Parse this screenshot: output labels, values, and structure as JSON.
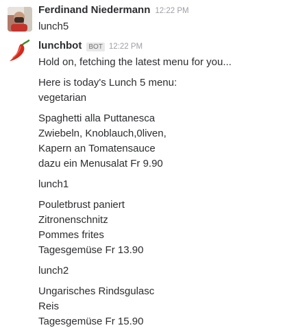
{
  "messages": [
    {
      "sender": "Ferdinand Niedermann",
      "timestamp": "12:22 PM",
      "avatar_icon": "user-photo-avatar",
      "lines": [
        "lunch5"
      ]
    },
    {
      "sender": "lunchbot",
      "badge": "BOT",
      "timestamp": "12:22 PM",
      "avatar_icon": "chili-pepper-avatar",
      "paragraphs": [
        [
          "Hold on, fetching the latest menu for you..."
        ],
        [
          "Here is today's Lunch 5 menu:",
          "vegetarian"
        ],
        [
          "Spaghetti alla Puttanesca",
          "Zwiebeln, Knoblauch,0liven,",
          "Kapern an Tomatensauce",
          "dazu ein Menusalat Fr 9.90"
        ],
        [
          "lunch1"
        ],
        [
          "Pouletbrust paniert",
          "Zitronenschnitz",
          "Pommes frites",
          "Tagesgemüse Fr 13.90"
        ],
        [
          "lunch2"
        ],
        [
          "Ungarisches Rindsgulasc",
          "Reis",
          "Tagesgemüse Fr 15.90"
        ]
      ]
    }
  ],
  "colors": {
    "text": "#2c2d30",
    "timestamp": "#9e9ea6",
    "badge_bg": "#e8e8e8",
    "chili_red": "#d42a1c",
    "chili_stem": "#3f8a25"
  }
}
